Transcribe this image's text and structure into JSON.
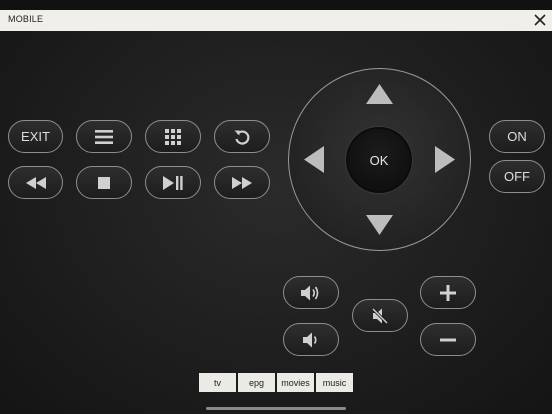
{
  "header": {
    "title": "MOBILE",
    "close_icon": "close-icon"
  },
  "remote": {
    "exit_label": "EXIT",
    "menu_icon": "menu-icon",
    "grid_icon": "grid-icon",
    "back_icon": "back-icon",
    "rewind_icon": "rewind-icon",
    "stop_icon": "stop-icon",
    "play_pause_icon": "play-pause-icon",
    "fast_forward_icon": "fast-forward-icon"
  },
  "dpad": {
    "ok_label": "OK"
  },
  "power": {
    "on_label": "ON",
    "off_label": "OFF"
  },
  "volume": {
    "up_icon": "volume-up-icon",
    "down_icon": "volume-down-icon",
    "mute_icon": "mute-icon"
  },
  "channel": {
    "plus_icon": "plus-icon",
    "minus_icon": "minus-icon"
  },
  "tabs": [
    {
      "label": "tv"
    },
    {
      "label": "epg"
    },
    {
      "label": "movies"
    },
    {
      "label": "music"
    }
  ],
  "colors": {
    "background": "#1e1e1e",
    "titlebar": "#f1efe9",
    "button_border": "#8e8e8e",
    "icon": "#d0d0d0"
  }
}
